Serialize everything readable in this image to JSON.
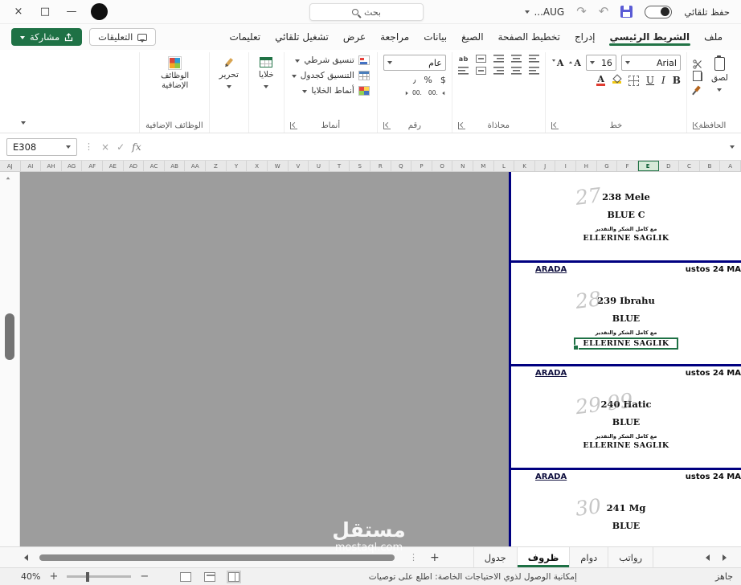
{
  "titlebar": {
    "autosave_label": "حفظ تلقائي",
    "filename": "AUG...",
    "search_placeholder": "بحث",
    "undo": "↶",
    "redo": "↷",
    "close": "×",
    "maximize": "□",
    "minimize": "—"
  },
  "quick_actions": {
    "share_label": "مشاركة",
    "comments_label": "التعليقات"
  },
  "ribbon_tabs": [
    {
      "label": "ملف",
      "active": false
    },
    {
      "label": "الشريط الرئيسي",
      "active": true
    },
    {
      "label": "إدراج",
      "active": false
    },
    {
      "label": "تخطيط الصفحة",
      "active": false
    },
    {
      "label": "الصيغ",
      "active": false
    },
    {
      "label": "بيانات",
      "active": false
    },
    {
      "label": "مراجعة",
      "active": false
    },
    {
      "label": "عرض",
      "active": false
    },
    {
      "label": "تشغيل تلقائي",
      "active": false
    },
    {
      "label": "تعليمات",
      "active": false
    }
  ],
  "ribbon": {
    "clipboard": {
      "label": "الحافظة",
      "paste_label": "لصق"
    },
    "font": {
      "label": "خط",
      "font_name": "Arial",
      "font_size": "16",
      "bold": "B",
      "italic": "I",
      "underline": "U",
      "grow": "A",
      "shrink": "A"
    },
    "alignment": {
      "label": "محاذاة",
      "wrap_label": "ab"
    },
    "number": {
      "label": "رقم",
      "format": "عام",
      "currency": "$",
      "percent": "%",
      "comma": "٫",
      "dec": ".00"
    },
    "styles": {
      "label": "أنماط",
      "items": [
        "تنسيق شرطي",
        "التنسيق كجدول",
        "أنماط الخلايا"
      ]
    },
    "cells": {
      "label": "خلايا"
    },
    "editing": {
      "label": "تحرير"
    },
    "addins": {
      "label": "الوظائف الإضافية"
    }
  },
  "formula_bar": {
    "name_box": "E308",
    "cancel": "×",
    "enter": "✓",
    "fx_label": "fx"
  },
  "grid": {
    "columns": [
      "AJ",
      "AI",
      "AH",
      "AG",
      "AF",
      "AE",
      "AD",
      "AC",
      "AB",
      "AA",
      "Z",
      "Y",
      "X",
      "W",
      "V",
      "U",
      "T",
      "S",
      "R",
      "Q",
      "P",
      "O",
      "N",
      "M",
      "L",
      "K",
      "J",
      "I",
      "H",
      "G",
      "F",
      "E",
      "D",
      "C",
      "B",
      "A"
    ],
    "selected_column": "E",
    "selected_cell": "E308",
    "divider": {
      "left": "ARADA",
      "right": "ustos 24 MA"
    },
    "records": [
      {
        "id": "238",
        "name": "Mele",
        "hand": "27",
        "line2": "BLUE C",
        "thanks": "مع كامل الشكر والتقدير",
        "footer": "ELLERINE SAGLIK",
        "selected": false
      },
      {
        "id": "239",
        "name": "Ibrahu",
        "hand": "28",
        "line2": "BLUE",
        "thanks": "مع كامل الشكر والتقدير",
        "footer": "ELLERINE SAGLIK",
        "selected": true
      },
      {
        "id": "240",
        "name": "Hatic",
        "hand": "29 99",
        "line2": "BLUE",
        "thanks": "مع كامل الشكر والتقدير",
        "footer": "ELLERINE SAGLIK",
        "selected": false
      },
      {
        "id": "241",
        "name": "Mg",
        "hand": "30",
        "line2": "BLUE",
        "thanks": "",
        "footer": "",
        "selected": false
      }
    ]
  },
  "sheet_bar": {
    "add_label": "+",
    "tabs": [
      {
        "label": "جدول",
        "active": false
      },
      {
        "label": "ظروف",
        "active": true
      },
      {
        "label": "دوام",
        "active": false
      },
      {
        "label": "رواتب",
        "active": false
      }
    ]
  },
  "status_bar": {
    "zoom": "40%",
    "accessibility": "إمكانية الوصول لذوي الاحتياجات الخاصة: اطلع على توصيات",
    "ready": "جاهز"
  },
  "watermark": {
    "title": "مستقل",
    "domain": "mostaql.com"
  }
}
